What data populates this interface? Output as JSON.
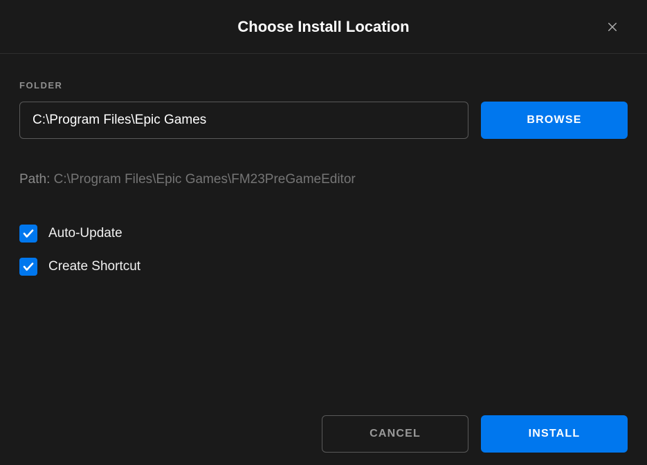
{
  "header": {
    "title": "Choose Install Location"
  },
  "folder": {
    "label": "FOLDER",
    "value": "C:\\Program Files\\Epic Games",
    "browse_label": "BROWSE"
  },
  "path": {
    "label": "Path:",
    "value": "C:\\Program Files\\Epic Games\\FM23PreGameEditor"
  },
  "options": {
    "auto_update": {
      "label": "Auto-Update",
      "checked": true
    },
    "create_shortcut": {
      "label": "Create Shortcut",
      "checked": true
    }
  },
  "footer": {
    "cancel_label": "CANCEL",
    "install_label": "INSTALL"
  },
  "colors": {
    "accent": "#0077ee",
    "background": "#1a1a1a"
  }
}
